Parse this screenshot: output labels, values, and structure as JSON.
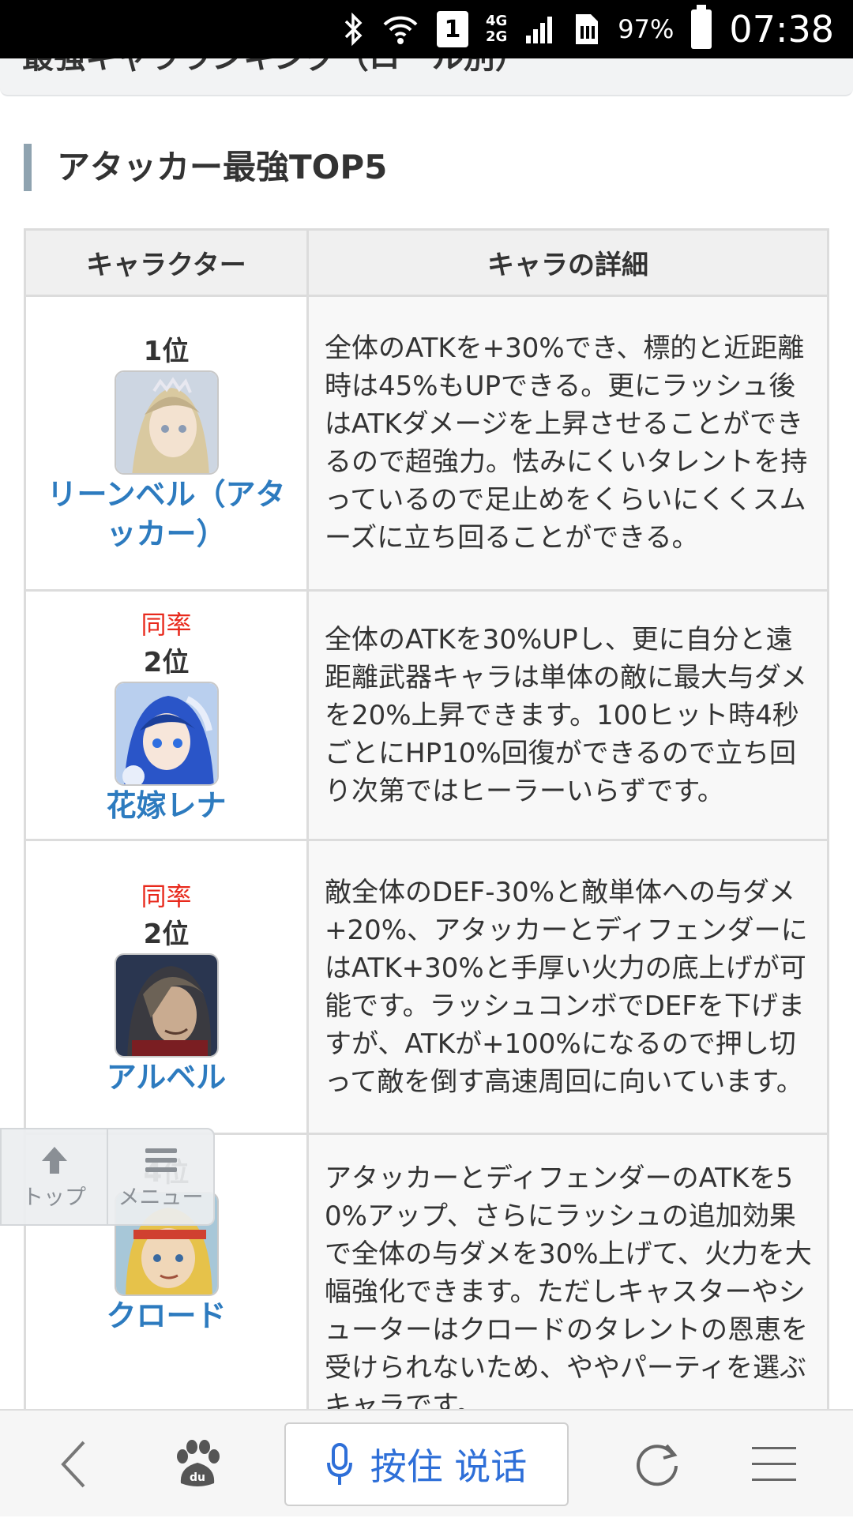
{
  "status_bar": {
    "sim_slot": "1",
    "network_top": "4G",
    "network_bottom": "2G",
    "battery": "97%",
    "time": "07:38"
  },
  "page": {
    "top_strip_text": "最強キャラランキング（ロール別）",
    "section_title": "アタッカー最強TOP5"
  },
  "table": {
    "headers": [
      "キャラクター",
      "キャラの詳細"
    ],
    "rows": [
      {
        "same_rate": "",
        "rank": "1位",
        "name": "リーンベル（アタッカー）",
        "detail": "全体のATKを+30%でき、標的と近距離時は45%もUPできる。更にラッシュ後はATKダメージを上昇させることができるので超強力。怯みにくいタレントを持っているので足止めをくらいにくくスムーズに立ち回ることができる。",
        "portrait_colors": [
          "#d9c9a0",
          "#c2b08a",
          "#8a9bb4"
        ]
      },
      {
        "same_rate": "同率",
        "rank": "2位",
        "name": "花嫁レナ",
        "detail": "全体のATKを30%UPし、更に自分と遠距離武器キャラは単体の敵に最大与ダメを20%上昇できます。100ヒット時4秒ごとにHP10%回復ができるので立ち回り次第ではヒーラーいらずです。",
        "portrait_colors": [
          "#2a55c8",
          "#1b3f9a",
          "#e8eefa"
        ]
      },
      {
        "same_rate": "同率",
        "rank": "2位",
        "name": "アルベル",
        "detail": "敵全体のDEF-30%と敵単体への与ダメ+20%、アタッカーとディフェンダーにはATK+30%と手厚い火力の底上げが可能です。ラッシュコンボでDEFを下げますが、ATKが+100%になるので押し切って敵を倒す高速周回に向いています。",
        "portrait_colors": [
          "#3a3a40",
          "#6c6256",
          "#2a3650"
        ]
      },
      {
        "same_rate": "",
        "rank": "4位",
        "name": "クロード",
        "detail": "アタッカーとディフェンダーのATKを50%アップ、さらにラッシュの追加効果で全体の与ダメを30%上げて、火力を大幅強化できます。ただしキャスターやシューターはクロードのタレントの恩恵を受けられないため、ややパーティを選ぶキャラです。",
        "portrait_colors": [
          "#e6c24a",
          "#d04030",
          "#f0d7b8"
        ]
      }
    ]
  },
  "float_nav": {
    "top_label": "トップ",
    "menu_label": "メニュー"
  },
  "bottom_bar": {
    "voice_label": "按住 说话"
  }
}
